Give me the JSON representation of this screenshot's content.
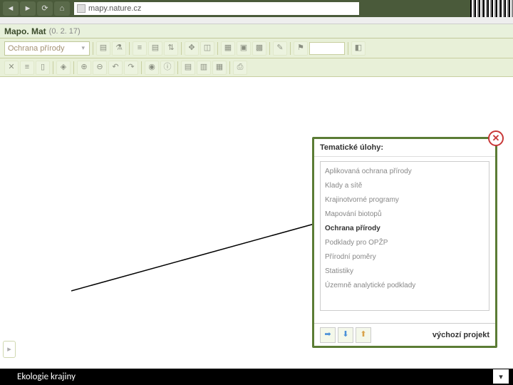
{
  "browser": {
    "url": "mapy.nature.cz"
  },
  "app": {
    "name": "Mapo. Mat",
    "version": "(0. 2. 17)"
  },
  "dropdown": {
    "label": "Ochrana přírody"
  },
  "dialog": {
    "title": "Tematické úlohy:",
    "items": [
      {
        "label": "Aplikovaná ochrana přírody",
        "selected": false
      },
      {
        "label": "Klady a sítě",
        "selected": false
      },
      {
        "label": "Krajinotvorné programy",
        "selected": false
      },
      {
        "label": "Mapování biotopů",
        "selected": false
      },
      {
        "label": "Ochrana přírody",
        "selected": true
      },
      {
        "label": "Podklady pro OPŽP",
        "selected": false
      },
      {
        "label": "Přírodní poměry",
        "selected": false
      },
      {
        "label": "Statistiky",
        "selected": false
      },
      {
        "label": "Územně analytické podklady",
        "selected": false
      }
    ],
    "footer_link": "výchozí projekt"
  },
  "footer": {
    "text": "Ekologie krajiny"
  }
}
